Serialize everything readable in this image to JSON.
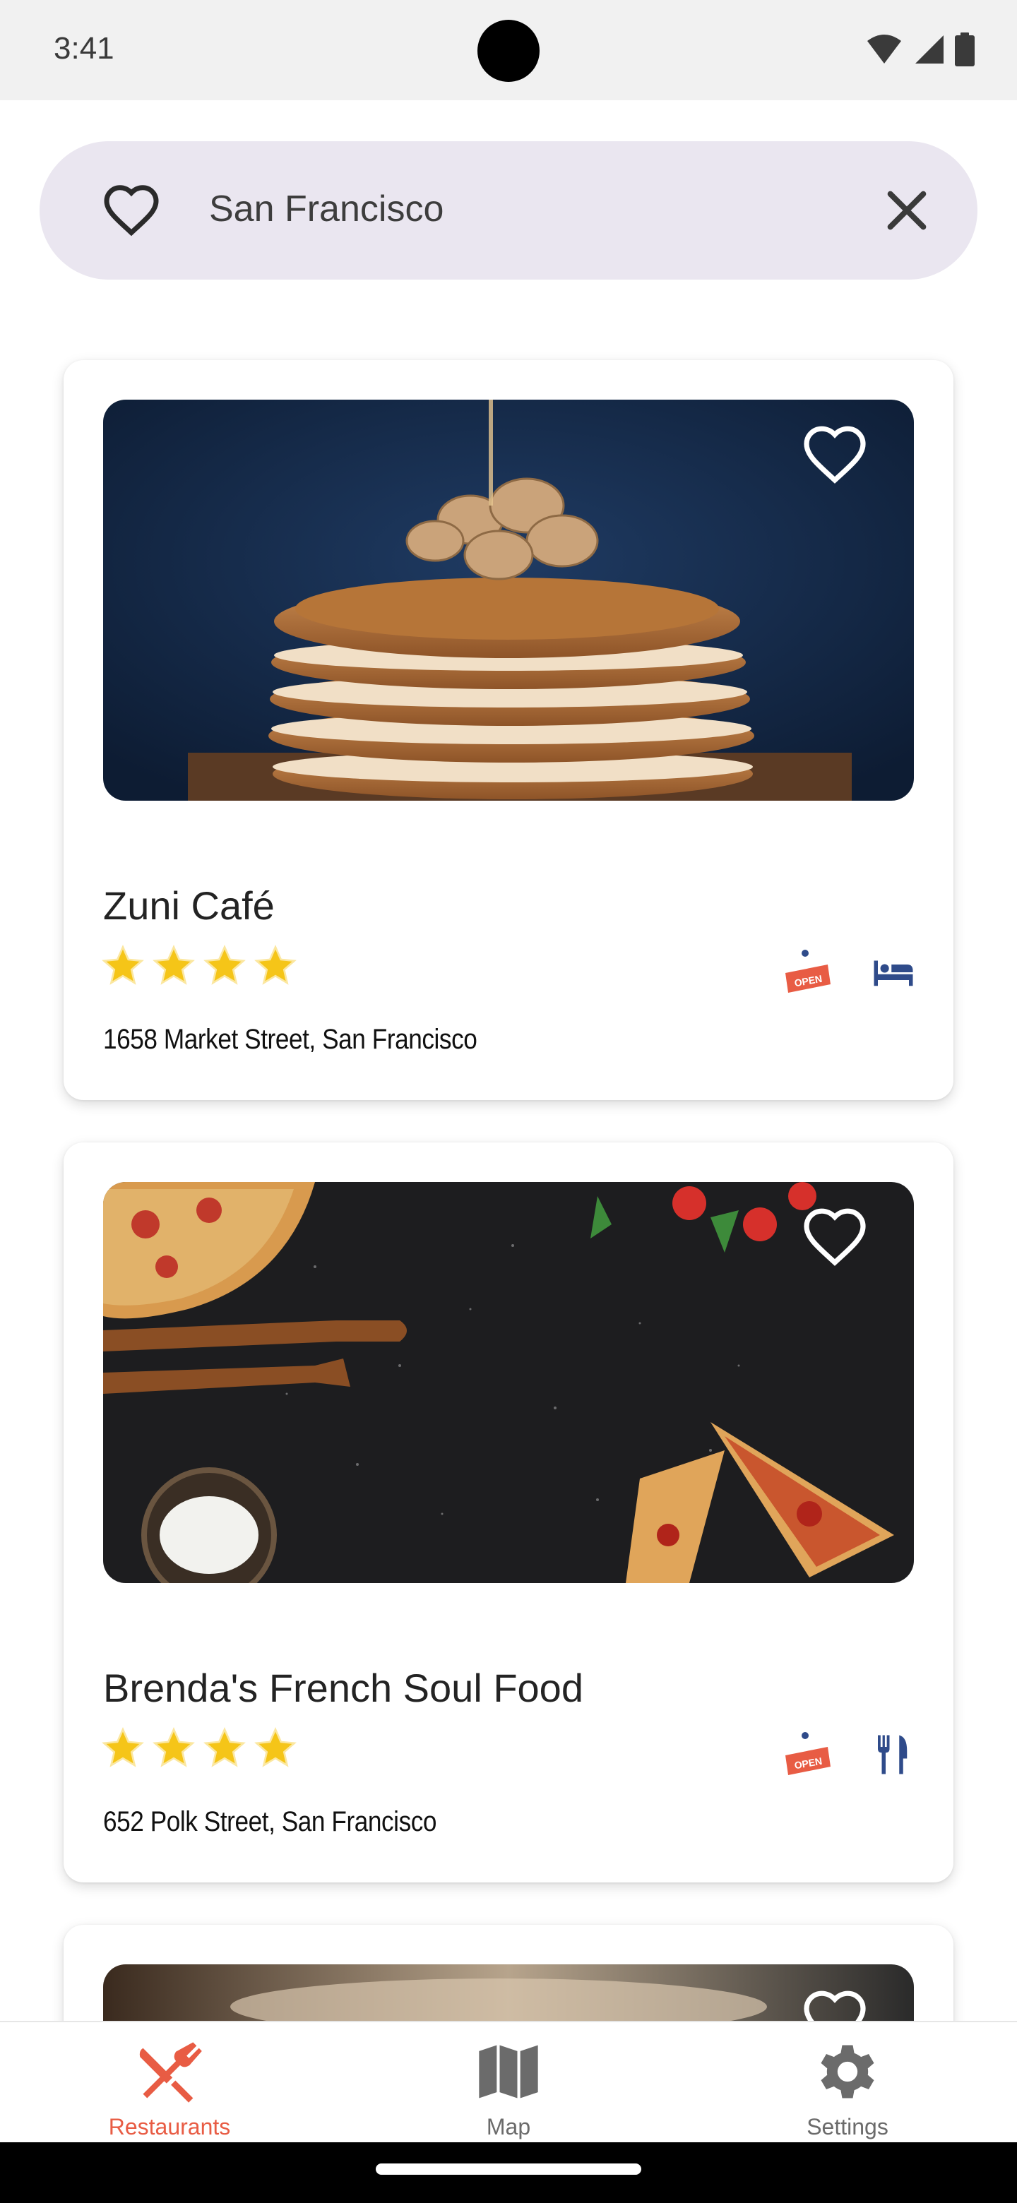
{
  "status_bar": {
    "time": "3:41"
  },
  "search": {
    "value": "San Francisco",
    "fav_icon": "heart-outline-icon",
    "clear_icon": "close-icon"
  },
  "restaurants": [
    {
      "name": "Zuni Café",
      "rating": 4,
      "address": "1658 Market Street, San Francisco",
      "status_icon": "open-sign-icon",
      "amenity_icon": "bed-icon",
      "image": "pancakes-photo"
    },
    {
      "name": "Brenda's French Soul Food",
      "rating": 4,
      "address": "652 Polk Street, San Francisco",
      "status_icon": "open-sign-icon",
      "amenity_icon": "utensils-icon",
      "image": "pizza-photo"
    },
    {
      "image": "blurred-photo"
    }
  ],
  "bottom_nav": {
    "items": [
      {
        "label": "Restaurants",
        "icon": "utensils-cross-icon",
        "active": true
      },
      {
        "label": "Map",
        "icon": "map-icon",
        "active": false
      },
      {
        "label": "Settings",
        "icon": "gear-icon",
        "active": false
      }
    ]
  },
  "colors": {
    "accent": "#e85c44",
    "navy": "#2f4b8a",
    "star": "#f5c518",
    "search_bg": "#eae6f0",
    "inactive": "#6b6b6b"
  }
}
